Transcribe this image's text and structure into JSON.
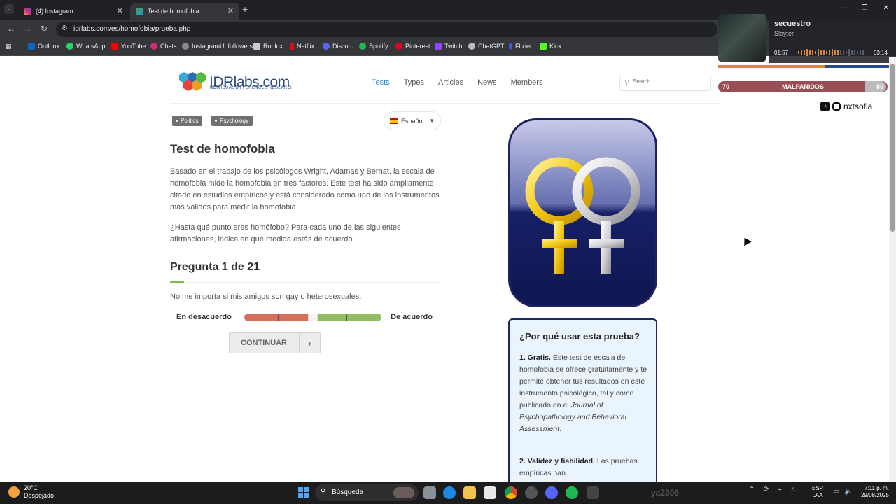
{
  "browser": {
    "tabs": [
      {
        "title": "(4) Instagram",
        "icon": "instagram-icon",
        "active": false
      },
      {
        "title": "Test de homofobia",
        "icon": "idrlabs-favicon",
        "active": true
      }
    ],
    "new_tab": "+",
    "url": "idrlabs.com/es/homofobia/prueba.php",
    "bookmarks": [
      "Outlook",
      "WhatsApp",
      "YouTube",
      "Chats",
      "InstagramUnfollowers",
      "Roblox",
      "Netflix",
      "Discord",
      "Spotify",
      "Pinterest",
      "Twitch",
      "ChatGPT",
      "Flixier",
      "Kick"
    ]
  },
  "site": {
    "logo_text": "IDRlabs",
    "logo_suffix": ".com",
    "logo_subtitle": "INDIVIDUAL DIFFERENCES RESEARCH",
    "nav": [
      "Tests",
      "Types",
      "Articles",
      "News",
      "Members"
    ],
    "search_placeholder": "Search..."
  },
  "tags": [
    "Politics",
    "Psychology"
  ],
  "language": "Español",
  "test": {
    "title": "Test de homofobia",
    "intro": "Basado en el trabajo de los psicólogos Wright, Adamas y Bernat, la escala de homofobia mide la homofobia en tres factores. Este test ha sido ampliamente citado en estudios empíricos y está considerado como uno de los instrumentos más válidos para medir la homofobia.",
    "instructions": "¿Hasta qué punto eres homófobo? Para cada uno de las siguientes afirmaciones, indica en qué medida estás de acuerdo.",
    "question_heading": "Pregunta 1 de 21",
    "question": "No me importa si mis amigos son gay o heterosexuales.",
    "scale_left": "En desacuerdo",
    "scale_right": "De acuerdo",
    "continue": "CONTINUAR"
  },
  "why": {
    "title": "¿Por qué usar esta prueba?",
    "item1_head": "1. Gratis.",
    "item1_body": " Este test de escala de homofobia se ofrece gratuitamente y te permite obtener tus resultados en este instrumento psicológico, tal y como publicado en el ",
    "item1_journal": "Journal of Psychopathology and Behavioral Assessment",
    "item1_end": ".",
    "item2_head": "2. Validez y fiabilidad.",
    "item2_body": " Las pruebas empíricas han"
  },
  "media": {
    "title": "secuestro",
    "artist": "Slayter",
    "current": "01:57",
    "total": "03:14",
    "progress": 0.6
  },
  "overlay": {
    "level_left": "70",
    "level_name": "MALPARIDOS",
    "level_right": "80",
    "handle": "nxtsofia"
  },
  "taskbar": {
    "temp": "20°C",
    "weather": "Despejado",
    "search": "Búsqueda",
    "marquee": "ya2306",
    "lang_top": "ESP",
    "lang_bottom": "LAA",
    "time": "7:11 p. m.",
    "date": "29/08/2025"
  },
  "colors": {
    "disagree": "#d3705b",
    "agree": "#94bd62",
    "accent": "#2a8cc7",
    "box_border": "#1a2b5a"
  }
}
